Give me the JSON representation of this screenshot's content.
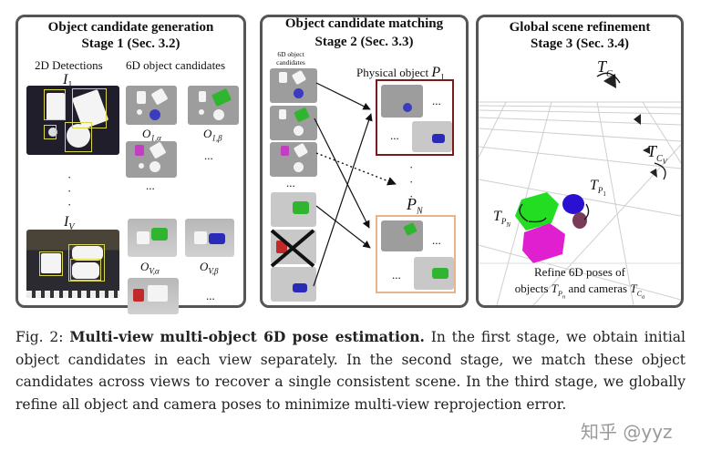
{
  "stage1": {
    "title_line1": "Object candidate generation",
    "title_line2": "Stage 1 (Sec. 3.2)",
    "col_left_label": "2D Detections",
    "col_right_label": "6D object candidates",
    "view_first": "I",
    "view_first_sub": "1",
    "view_last": "I",
    "view_last_sub": "V",
    "vertical_dots": "·",
    "candidates": [
      {
        "label": "O",
        "sub": "1,α",
        "object_color": "#3b3bbf"
      },
      {
        "label": "O",
        "sub": "1,β",
        "object_color": "#2fb52f"
      },
      {
        "label": "",
        "sub": "",
        "object_color": "#c23fc2"
      },
      {
        "label": "O",
        "sub": "V,α",
        "object_color": "#2fb52f"
      },
      {
        "label": "O",
        "sub": "V,β",
        "object_color": "#2a2ab8"
      },
      {
        "label": "",
        "sub": "",
        "object_color": "#c22a2a"
      }
    ],
    "ellipsis": "..."
  },
  "stage2": {
    "title_line1": "Object candidate matching",
    "title_line2": "Stage 2 (Sec. 3.3)",
    "left_label_line1": "6D object",
    "left_label_line2": "candidates",
    "physical_object_label": "Physical object",
    "p1_symbol": "P",
    "p1_sub": "1",
    "pn_symbol": "P",
    "pn_sub": "N",
    "p1_box_color": "#7a1a1a",
    "pn_box_color": "#e8b48c",
    "ellipsis": "..."
  },
  "stage3": {
    "title_line1": "Global scene refinement",
    "title_line2": "Stage 3 (Sec. 3.4)",
    "tc1_symbol": "T",
    "tc1_sub": "C",
    "tc1_subsub": "1",
    "tcv_symbol": "T",
    "tcv_sub": "C",
    "tcv_subsub": "V",
    "tp1_symbol": "T",
    "tp1_sub": "P",
    "tp1_subsub": "1",
    "tpn_symbol": "T",
    "tpn_sub": "P",
    "tpn_subsub": "N",
    "footer_line1": "Refine 6D poses of",
    "footer_line2_a": "objects",
    "footer_line2_b": "and cameras",
    "footer_tp": "T",
    "footer_tp_sub": "P",
    "footer_tp_subsub": "n",
    "footer_tc": "T",
    "footer_tc_sub": "C",
    "footer_tc_subsub": "a",
    "object_colors": {
      "green": "#22dd22",
      "blue": "#2a10d0",
      "purple": "#7a3a5a",
      "magenta": "#e020d0"
    }
  },
  "caption": {
    "prefix": "Fig. 2: ",
    "bold": "Multi-view multi-object 6D pose estimation.",
    "body": " In the first stage, we obtain initial object candidates in each view separately. In the second stage, we match these object candidates across views to recover a single consistent scene. In the third stage, we globally refine all object and camera poses to minimize multi-view reprojection error."
  },
  "watermark": "知乎 @yyz"
}
